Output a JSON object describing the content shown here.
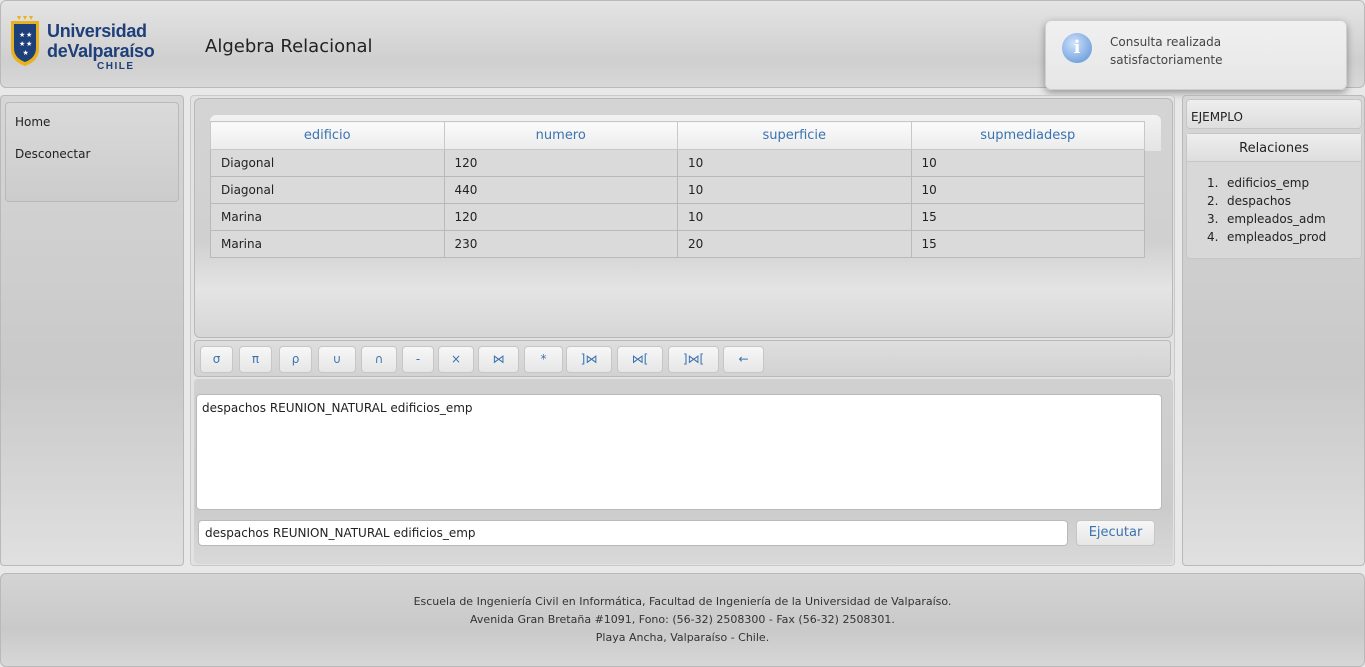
{
  "header": {
    "logo": {
      "line1": "Universidad",
      "line2": "deValparaíso",
      "line3": "CHILE"
    },
    "title": "Algebra Relacional"
  },
  "notification": {
    "icon": "info-icon",
    "line1": "Consulta realizada",
    "line2": "satisfactoriamente"
  },
  "left_menu": {
    "items": [
      {
        "label": "Home"
      },
      {
        "label": "Desconectar"
      }
    ]
  },
  "result": {
    "columns": [
      "edificio",
      "numero",
      "superficie",
      "supmediadesp"
    ],
    "rows": [
      [
        "Diagonal",
        "120",
        "10",
        "10"
      ],
      [
        "Diagonal",
        "440",
        "10",
        "10"
      ],
      [
        "Marina",
        "120",
        "10",
        "15"
      ],
      [
        "Marina",
        "230",
        "20",
        "15"
      ]
    ]
  },
  "operators": [
    "σ",
    "π",
    "ρ",
    "∪",
    "∩",
    "-",
    "×",
    "⋈",
    "*",
    "]⋈",
    "⋈[",
    "]⋈[",
    "←"
  ],
  "editor": {
    "textarea_value": "despachos REUNION_NATURAL edificios_emp",
    "input_value": "despachos REUNION_NATURAL edificios_emp",
    "run_label": "Ejecutar"
  },
  "right_panel": {
    "example_label": "EJEMPLO",
    "relations_title": "Relaciones",
    "relations": [
      {
        "num": "1.",
        "name": "edificios_emp"
      },
      {
        "num": "2.",
        "name": "despachos"
      },
      {
        "num": "3.",
        "name": "empleados_adm"
      },
      {
        "num": "4.",
        "name": "empleados_prod"
      }
    ]
  },
  "footer": {
    "line1": "Escuela de Ingeniería Civil en Informática, Facultad de Ingeniería de la Universidad de Valparaíso.",
    "line2": "Avenida Gran Bretaña #1091, Fono: (56-32) 2508300 - Fax (56-32) 2508301.",
    "line3": "Playa Ancha, Valparaíso - Chile."
  },
  "colors": {
    "accent_blue": "#3a73b0",
    "brand_navy": "#1d3f7a",
    "brand_gold": "#e8b21e"
  }
}
